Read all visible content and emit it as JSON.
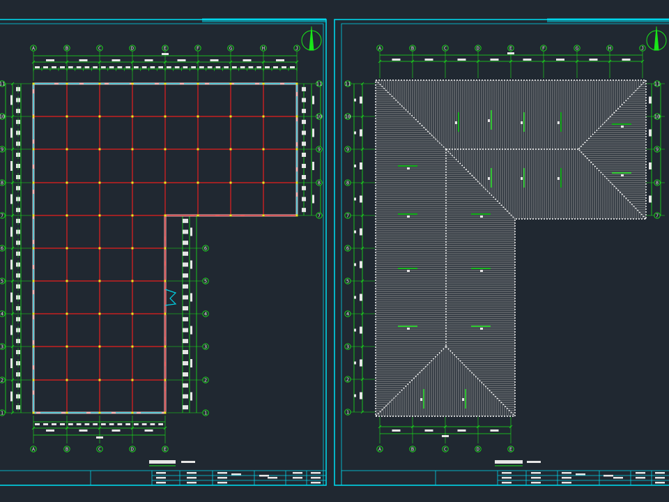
{
  "colors": {
    "background": "#202831",
    "frame": "#00d4e8",
    "dimension": "#19e619",
    "grid_line": "#e81e1e",
    "wall": "#f2b8b8",
    "roof_pattern": "#a0a0a0",
    "node": "#e8e81e",
    "text": "#e6e6e6"
  },
  "left_sheet": {
    "cols_top": [
      "A",
      "B",
      "C",
      "D",
      "E",
      "F",
      "G",
      "H",
      "J"
    ],
    "cols_bottom": [
      "A",
      "B",
      "C",
      "D",
      "E"
    ],
    "rows_left": [
      "1",
      "2",
      "3",
      "4",
      "5",
      "6",
      "7",
      "8",
      "9",
      "10",
      "11"
    ],
    "rows_right_upper": [
      "11",
      "10",
      "9",
      "8",
      "7"
    ],
    "rows_right_lower": [
      "6",
      "5",
      "4",
      "3",
      "2",
      "1"
    ]
  },
  "right_sheet": {
    "cols_top": [
      "A",
      "B",
      "C",
      "D",
      "E",
      "F",
      "G",
      "H",
      "J"
    ],
    "cols_bottom": [
      "A",
      "B",
      "C",
      "D",
      "E"
    ],
    "rows_left": [
      "1",
      "2",
      "3",
      "4",
      "5",
      "6",
      "7",
      "8",
      "9",
      "10",
      "11"
    ],
    "rows_right": [
      "11",
      "10",
      "9",
      "8",
      "7"
    ]
  },
  "icons": [
    "north-arrow-icon"
  ]
}
